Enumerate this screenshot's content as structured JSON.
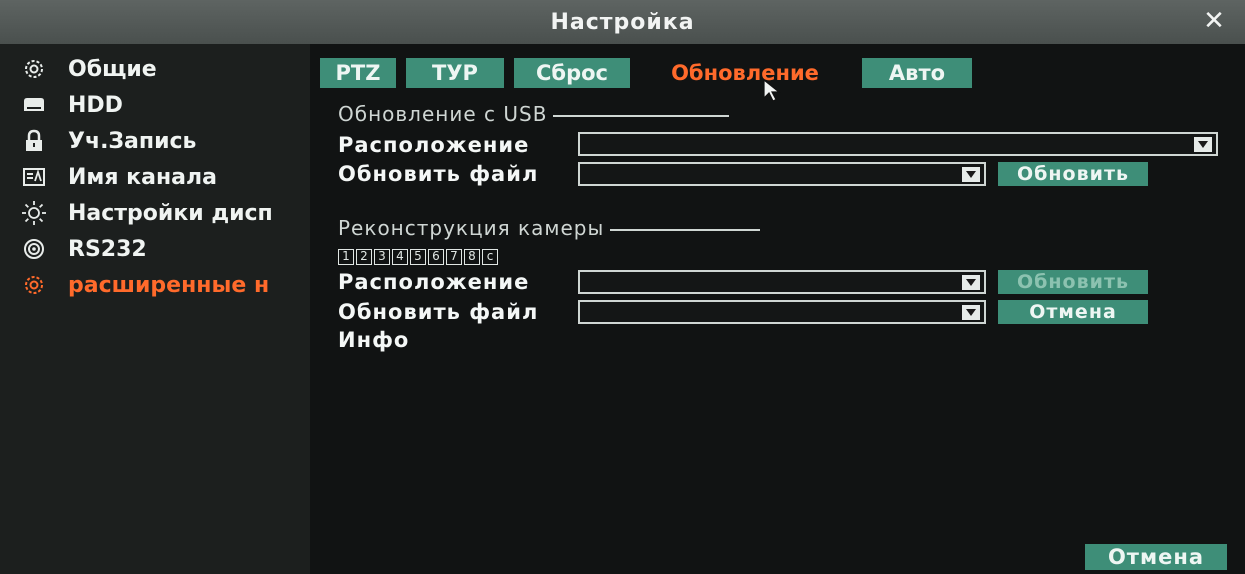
{
  "window": {
    "title": "Настройка"
  },
  "sidebar": {
    "items": [
      {
        "label": "Общие",
        "icon": "gear-icon"
      },
      {
        "label": "HDD",
        "icon": "hdd-icon"
      },
      {
        "label": "Уч.Запись",
        "icon": "lock-icon"
      },
      {
        "label": "Имя канала",
        "icon": "channel-name-icon"
      },
      {
        "label": "Настройки дисп",
        "icon": "brightness-icon"
      },
      {
        "label": "RS232",
        "icon": "rs232-icon"
      },
      {
        "label": "расширенные н",
        "icon": "gear-icon"
      }
    ]
  },
  "tabs": [
    "PTZ",
    "ТУР",
    "Сброс",
    "Обновление",
    "Авто"
  ],
  "usb_section": {
    "title": "Обновление с USB",
    "location_label": "Расположение",
    "file_label": "Обновить файл",
    "update_button": "Обновить"
  },
  "camera_section": {
    "title": "Реконструкция камеры",
    "channels": [
      "1",
      "2",
      "3",
      "4",
      "5",
      "6",
      "7",
      "8",
      "c"
    ],
    "location_label": "Расположение",
    "file_label": "Обновить файл",
    "update_button": "Обновить",
    "cancel_button": "Отмена",
    "info_label": "Инфо"
  },
  "footer": {
    "cancel_button": "Отмена"
  },
  "colors": {
    "accent": "#ff6a2b",
    "button": "#3e8e78",
    "titlebar": "#555b59"
  }
}
